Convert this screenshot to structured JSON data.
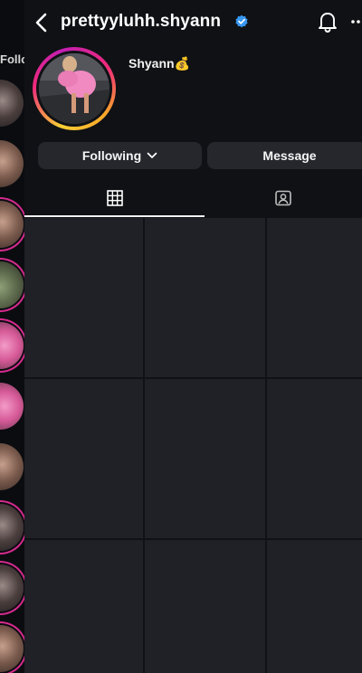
{
  "header": {
    "username": "prettyyluhh.shyann",
    "verified": true
  },
  "profile": {
    "display_name": "Shyann💰"
  },
  "actions": {
    "following_label": "Following",
    "message_label": "Message"
  },
  "rail": {
    "label": "Follo"
  },
  "tabs": [
    {
      "icon": "grid-icon",
      "active": true
    },
    {
      "icon": "tagged-icon",
      "active": false
    }
  ],
  "colors": {
    "background": "#0f1115",
    "button": "#25272d",
    "verified": "#3897f0",
    "story_ring": "#d42a8c"
  }
}
